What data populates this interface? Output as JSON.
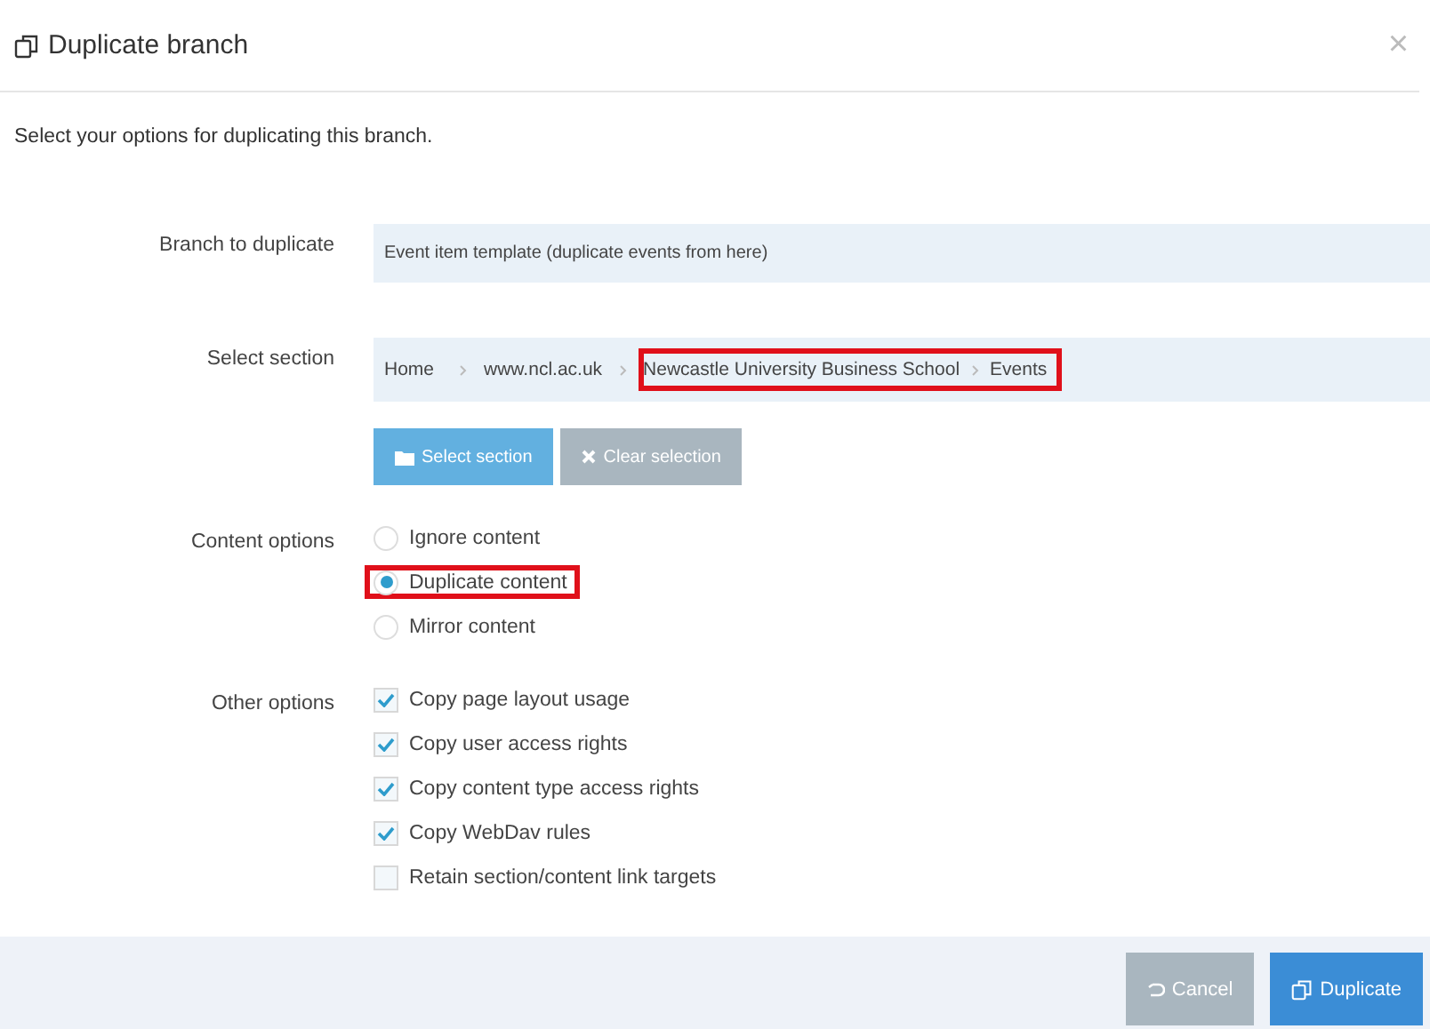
{
  "dialog": {
    "title": "Duplicate branch",
    "close": "×",
    "intro": "Select your options for duplicating this branch."
  },
  "branch": {
    "label": "Branch to duplicate",
    "value": "Event item template (duplicate events from here)"
  },
  "section": {
    "label": "Select section",
    "crumbs": [
      {
        "text": "Home",
        "highlighted": false
      },
      {
        "text": "www.ncl.ac.uk",
        "highlighted": false
      },
      {
        "text": "Newcastle University Business School",
        "highlighted": true
      },
      {
        "text": "Events",
        "highlighted": true
      }
    ],
    "buttons": [
      {
        "kind": "select",
        "label": "Select section"
      },
      {
        "kind": "clear",
        "label": "Clear selection"
      }
    ]
  },
  "content_options": {
    "label": "Content options",
    "options": [
      {
        "label": "Ignore content",
        "selected": false,
        "highlighted": false
      },
      {
        "label": "Duplicate content",
        "selected": true,
        "highlighted": true
      },
      {
        "label": "Mirror content",
        "selected": false,
        "highlighted": false
      }
    ]
  },
  "other_options": {
    "label": "Other options",
    "options": [
      {
        "label": "Copy page layout usage",
        "checked": true
      },
      {
        "label": "Copy user access rights",
        "checked": true
      },
      {
        "label": "Copy content type access rights",
        "checked": true
      },
      {
        "label": "Copy WebDav rules",
        "checked": true
      },
      {
        "label": "Retain section/content link targets",
        "checked": false
      }
    ]
  },
  "footer": {
    "buttons": [
      {
        "kind": "cancel",
        "label": "Cancel"
      },
      {
        "kind": "duplicate",
        "label": "Duplicate"
      }
    ]
  }
}
